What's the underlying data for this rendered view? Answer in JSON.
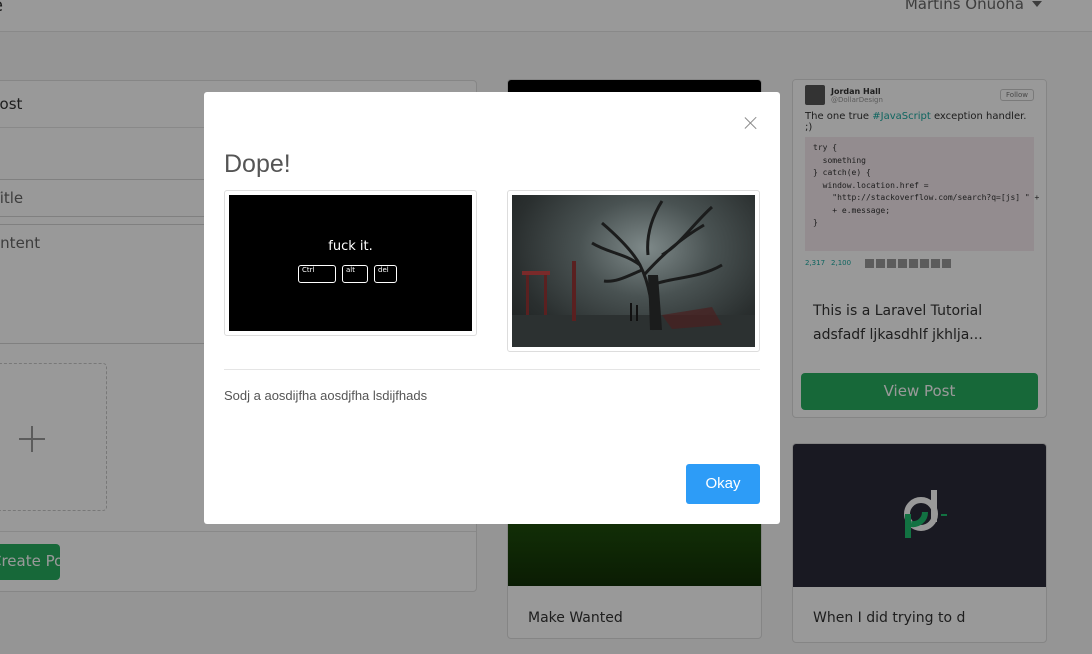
{
  "topbar": {
    "brand": "e",
    "user_name": "Martins Onuoha"
  },
  "form": {
    "header": "Post",
    "title_placeholder": "Title",
    "content_placeholder": "ontent",
    "create_label": "Create Post"
  },
  "posts": [
    {
      "text_line1": "This is a Laravel Tutorial",
      "text_line2": "adsfadf ljkasdhlf jkhlja...",
      "button": "View Post"
    },
    {
      "title_peek": "Make Wanted"
    },
    {
      "title_peek": "When I did trying to d"
    }
  ],
  "tweet": {
    "name": "Jordan Hall",
    "handle": "@DollarDesign",
    "follow": "Follow",
    "text_prefix": "The one true ",
    "hashtag": "#JavaScript",
    "text_suffix": " exception handler. ;)",
    "code": "try {\n  something\n} catch(e) {\n  window.location.href =\n    \"http://stackoverflow.com/search?q=[js] \" +\n    + e.message;\n}",
    "retweets": "2,317",
    "likes": "2,100"
  },
  "modal": {
    "title": "Dope!",
    "meme_text": "fuck it.",
    "keys": [
      "Ctrl",
      "alt",
      "del"
    ],
    "body": "Sodj a aosdijfha aosdjfha lsdijfhads",
    "okay_label": "Okay"
  },
  "colors": {
    "primary": "#2d9cf7",
    "success": "#27ae60",
    "overlay": "rgba(0,0,0,0.4)"
  }
}
